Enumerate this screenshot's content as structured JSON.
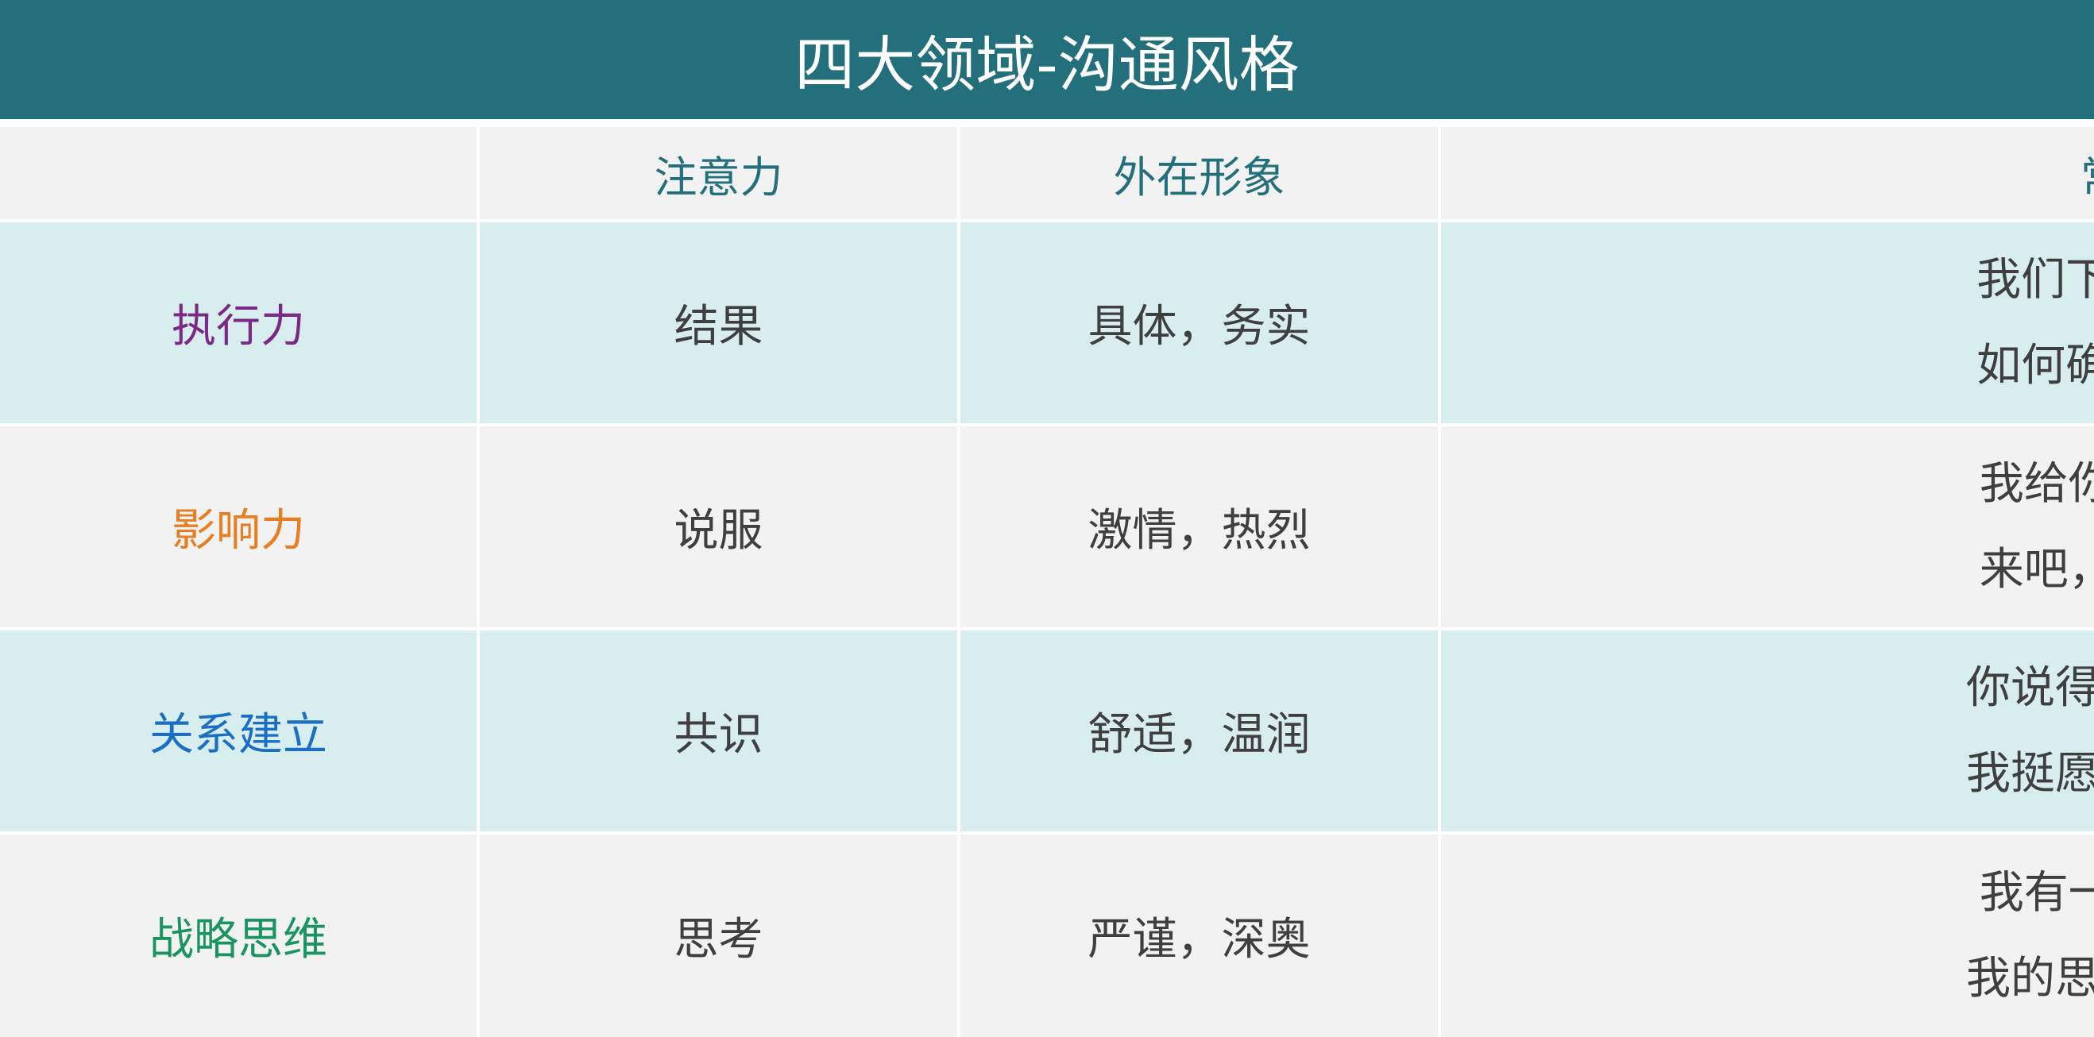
{
  "title": "四大领域-沟通风格",
  "header": {
    "columns": [
      "",
      "注意力",
      "外在形象",
      "常见话语"
    ]
  },
  "rows": [
    {
      "domain": "执行力",
      "domain_color": "#7a2a86",
      "focus": "结果",
      "image": "具体，务实",
      "phrases": [
        "我们下一步怎么做?",
        "如何确保事情完成?"
      ],
      "row_bg": "#d8edee"
    },
    {
      "domain": "影响力",
      "domain_color": "#e67e22",
      "focus": "说服",
      "image": "激情，热烈",
      "phrases": [
        "我给你们讲个故事!",
        "来吧，加入我们吧!"
      ],
      "row_bg": "#f2f2f2"
    },
    {
      "domain": "关系建立",
      "domain_color": "#1a6fc4",
      "focus": "共识",
      "image": "舒适，温润",
      "phrases": [
        "你说得挺有道理的。",
        "我挺愿意支持你的。"
      ],
      "row_bg": "#d8edee"
    },
    {
      "domain": "战略思维",
      "domain_color": "#1a9460",
      "focus": "思考",
      "image": "严谨，深奥",
      "phrases": [
        "我有一个不同看法!",
        "我的思路是这样的。"
      ],
      "row_bg": "#f2f2f2"
    }
  ],
  "colors": {
    "title_bar": "#236f7b",
    "header_text": "#236f7b",
    "body_text": "#3f3f3f",
    "teal_row": "#d8edee",
    "gray_row": "#f2f2f2"
  }
}
